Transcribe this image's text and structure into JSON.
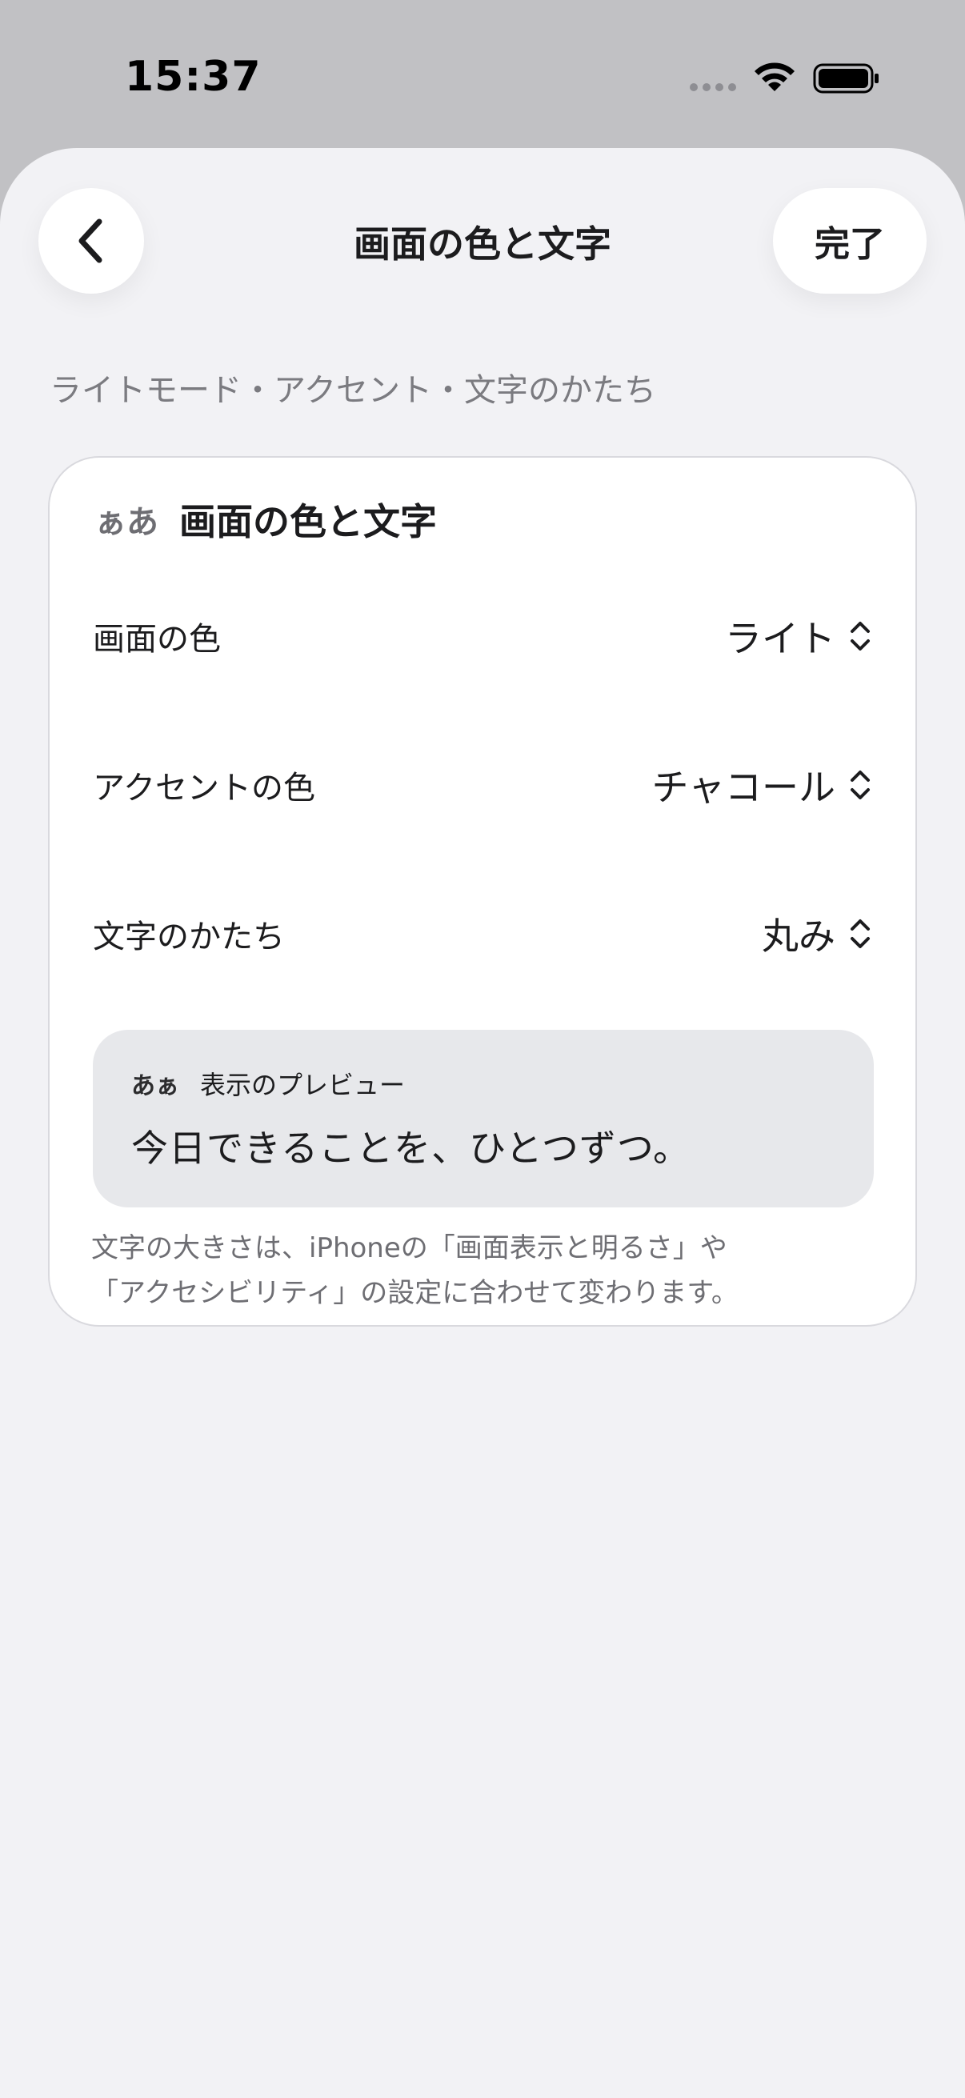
{
  "status_bar": {
    "time": "15:37",
    "icons": [
      "signal-dots-icon",
      "wifi-icon",
      "battery-icon"
    ]
  },
  "nav": {
    "back_icon": "chevron-left-icon",
    "title": "画面の色と文字",
    "done_label": "完了"
  },
  "section_subtitle": "ライトモード・アクセント・文字のかたち",
  "card": {
    "header_icon_text": "ぁあ",
    "title": "画面の色と文字",
    "rows": [
      {
        "label": "画面の色",
        "value": "ライト"
      },
      {
        "label": "アクセントの色",
        "value": "チャコール"
      },
      {
        "label": "文字のかたち",
        "value": "丸み"
      }
    ],
    "preview": {
      "icon_text": "あぁ",
      "label": "表示のプレビュー",
      "sample_text": "今日できることを、ひとつずつ。"
    },
    "note_line1": "文字の大きさは、iPhoneの「画面表示と明るさ」や",
    "note_line2": "「アクセシビリティ」の設定に合わせて変わります。"
  },
  "colors": {
    "sheet_background": "#f2f2f5",
    "card_background": "#ffffff",
    "preview_background": "#e7e8eb",
    "text_primary": "#1c1c1e",
    "text_secondary": "#6e6e73"
  }
}
